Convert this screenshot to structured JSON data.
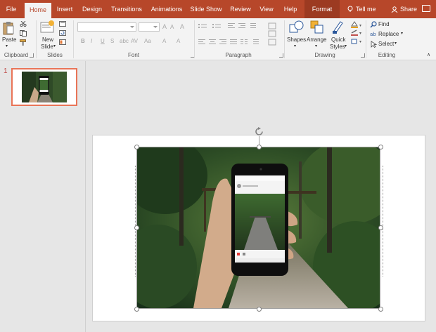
{
  "tabs": [
    {
      "label": "File"
    },
    {
      "label": "Home"
    },
    {
      "label": "Insert"
    },
    {
      "label": "Design"
    },
    {
      "label": "Transitions"
    },
    {
      "label": "Animations"
    },
    {
      "label": "Slide Show"
    },
    {
      "label": "Review"
    },
    {
      "label": "View"
    },
    {
      "label": "Help"
    },
    {
      "label": "Format"
    }
  ],
  "tell_me": "Tell me",
  "share": "Share",
  "ribbon": {
    "clipboard": {
      "label": "Clipboard",
      "paste": "Paste"
    },
    "slides": {
      "label": "Slides",
      "new_slide_line1": "New",
      "new_slide_line2": "Slide"
    },
    "font": {
      "label": "Font",
      "bold": "B",
      "italic": "I",
      "underline": "U",
      "strike": "S",
      "grow": "A",
      "shrink": "A",
      "clear": "A",
      "shadow": "A",
      "case": "Aa"
    },
    "paragraph": {
      "label": "Paragraph"
    },
    "drawing": {
      "label": "Drawing",
      "shapes": "Shapes",
      "arrange": "Arrange",
      "quick_line1": "Quick",
      "quick_line2": "Styles"
    },
    "editing": {
      "label": "Editing",
      "find": "Find",
      "replace": "Replace",
      "select": "Select"
    }
  },
  "thumbnails": {
    "slide_number": "1"
  },
  "colors": {
    "accent": "#b7472a",
    "format_tab": "#9c3a21",
    "ribbon_bg": "#f3f3f3",
    "selection": "#e97457"
  }
}
